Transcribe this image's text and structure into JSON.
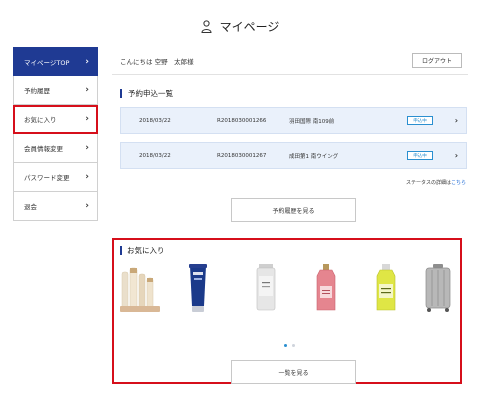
{
  "header": {
    "title": "マイページ",
    "icon": "user-icon"
  },
  "sidebar": {
    "items": [
      {
        "label": "マイページTOP",
        "active": true
      },
      {
        "label": "予約履歴"
      },
      {
        "label": "お気に入り",
        "highlighted": true
      },
      {
        "label": "会員情報変更"
      },
      {
        "label": "パスワード変更"
      },
      {
        "label": "退会"
      }
    ]
  },
  "main": {
    "greeting": "こんにちは 空野　太郎様",
    "logout_label": "ログアウト",
    "reservations": {
      "title": "予約申込一覧",
      "rows": [
        {
          "date": "2018/03/22",
          "number": "R2018030001266",
          "place": "羽田国際 南109前",
          "status": "申込中"
        },
        {
          "date": "2018/03/22",
          "number": "R2018030001267",
          "place": "成田第1 南ウイング",
          "status": "申込中"
        }
      ],
      "status_note": "ステータスの詳細は",
      "status_link": "こちら",
      "history_button": "予約履歴を見る"
    },
    "favorites": {
      "title": "お気に入り",
      "products": [
        {
          "name": "cosmetic-set"
        },
        {
          "name": "blue-tube"
        },
        {
          "name": "silver-bottle"
        },
        {
          "name": "pink-perfume"
        },
        {
          "name": "yellow-bottle"
        },
        {
          "name": "suitcase"
        }
      ],
      "pages": 2,
      "current_page": 1,
      "view_button": "一覧を見る"
    }
  },
  "colors": {
    "primary": "#1f3a93",
    "highlight": "#d60f1b",
    "accent": "#2a8fd0",
    "row_bg": "#eaf1fb"
  }
}
